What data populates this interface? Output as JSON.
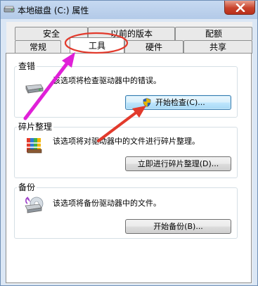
{
  "window": {
    "title": "本地磁盘 (C:) 属性"
  },
  "tabs_row1": [
    "安全",
    "以前的版本",
    "配额"
  ],
  "tabs_row2": [
    "常规",
    "工具",
    "硬件",
    "共享"
  ],
  "sections": {
    "error_check": {
      "title": "查错",
      "description": "该选项将检查驱动器中的错误。",
      "button": "开始检查(C)..."
    },
    "defrag": {
      "title": "碎片整理",
      "description": "该选项将对驱动器中的文件进行碎片整理。",
      "button": "立即进行碎片整理(D)..."
    },
    "backup": {
      "title": "备份",
      "description": "该选项将备份驱动器中的文件。",
      "button": "开始备份(B)..."
    }
  },
  "icons": {
    "title_icon": "drive-icon",
    "error_check_icon": "hard-drive-icon",
    "defrag_icon": "defrag-icon",
    "backup_icon": "backup-icon",
    "shield": "uac-shield-icon"
  },
  "colors": {
    "annotation_magenta": "#e020d8",
    "annotation_red": "#e23a2c",
    "close_red": "#c8422b"
  }
}
